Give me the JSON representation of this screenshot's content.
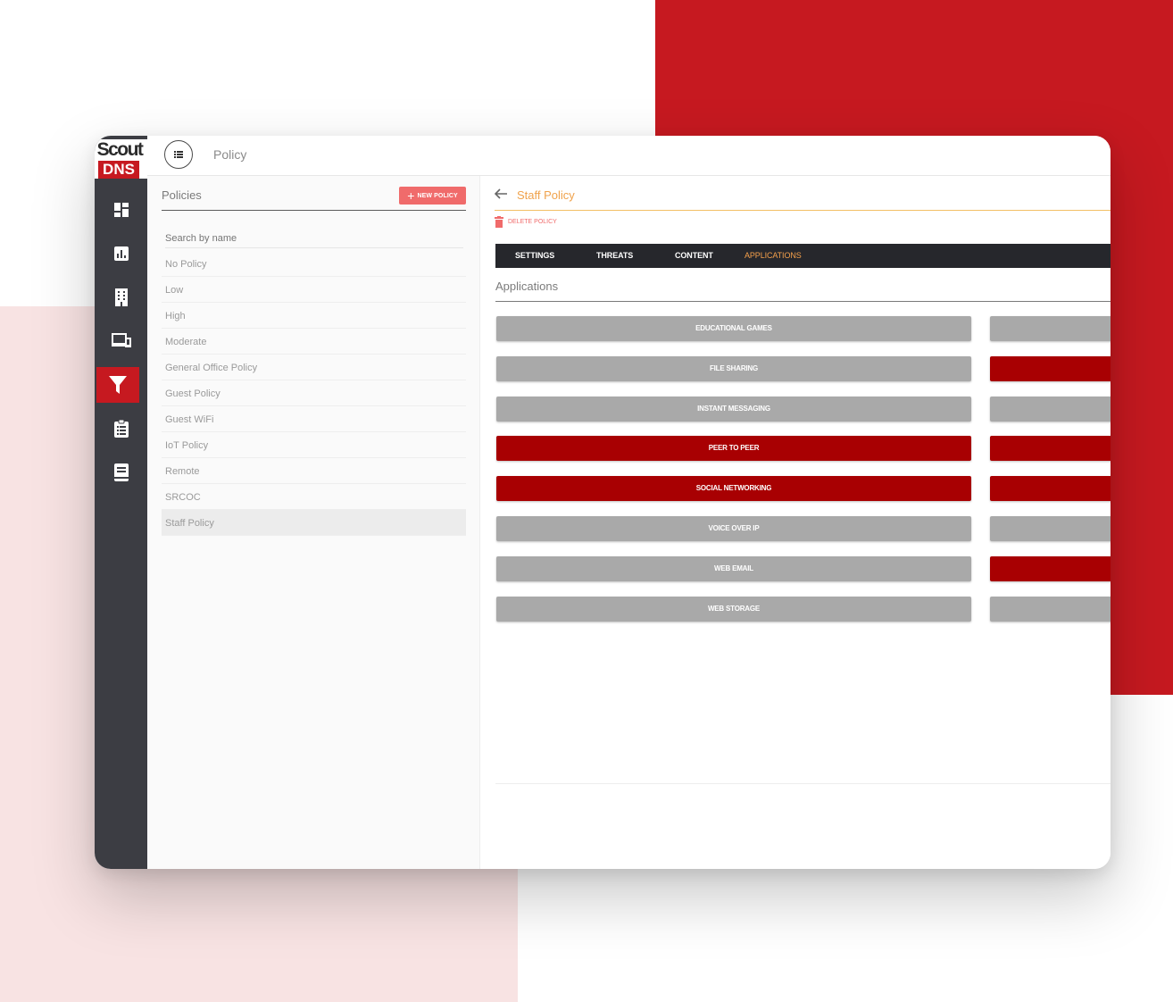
{
  "brand": {
    "logo_top": "Scout",
    "logo_bottom": "DNS",
    "accent": "#c61920"
  },
  "sidebar": {
    "items": [
      {
        "name": "dashboard-icon",
        "active": false
      },
      {
        "name": "reports-icon",
        "active": false
      },
      {
        "name": "building-icon",
        "active": false
      },
      {
        "name": "devices-icon",
        "active": false
      },
      {
        "name": "filter-icon",
        "active": true
      },
      {
        "name": "clipboard-icon",
        "active": false
      },
      {
        "name": "book-icon",
        "active": false
      }
    ]
  },
  "topbar": {
    "title": "Policy",
    "menu_icon": "list-icon"
  },
  "policies": {
    "title": "Policies",
    "new_button": "NEW POLICY",
    "search_placeholder": "Search by name",
    "items": [
      "No Policy",
      "Low",
      "High",
      "Moderate",
      "General Office Policy",
      "Guest Policy",
      "Guest WiFi",
      "IoT Policy",
      "Remote",
      "SRCOC",
      "Staff Policy"
    ],
    "selected": "Staff Policy"
  },
  "detail": {
    "title": "Staff Policy",
    "delete_label": "DELETE POLICY",
    "tabs": [
      {
        "label": "SETTINGS",
        "active": false
      },
      {
        "label": "THREATS",
        "active": false
      },
      {
        "label": "CONTENT",
        "active": false
      },
      {
        "label": "APPLICATIONS",
        "active": true
      }
    ],
    "section_title": "Applications",
    "applications_left": [
      {
        "label": "EDUCATIONAL GAMES",
        "blocked": false
      },
      {
        "label": "FILE SHARING",
        "blocked": false
      },
      {
        "label": "INSTANT MESSAGING",
        "blocked": false
      },
      {
        "label": "PEER TO PEER",
        "blocked": true
      },
      {
        "label": "SOCIAL NETWORKING",
        "blocked": true
      },
      {
        "label": "VOICE OVER IP",
        "blocked": false
      },
      {
        "label": "WEB EMAIL",
        "blocked": false
      },
      {
        "label": "WEB STORAGE",
        "blocked": false
      }
    ],
    "applications_right": [
      {
        "blocked": false
      },
      {
        "blocked": true
      },
      {
        "blocked": false
      },
      {
        "blocked": true
      },
      {
        "blocked": true
      },
      {
        "blocked": false
      },
      {
        "blocked": true
      },
      {
        "blocked": false
      }
    ],
    "colors": {
      "allowed": "#a9a9a9",
      "blocked": "#a80002",
      "active_tab": "#f5a04b"
    }
  }
}
